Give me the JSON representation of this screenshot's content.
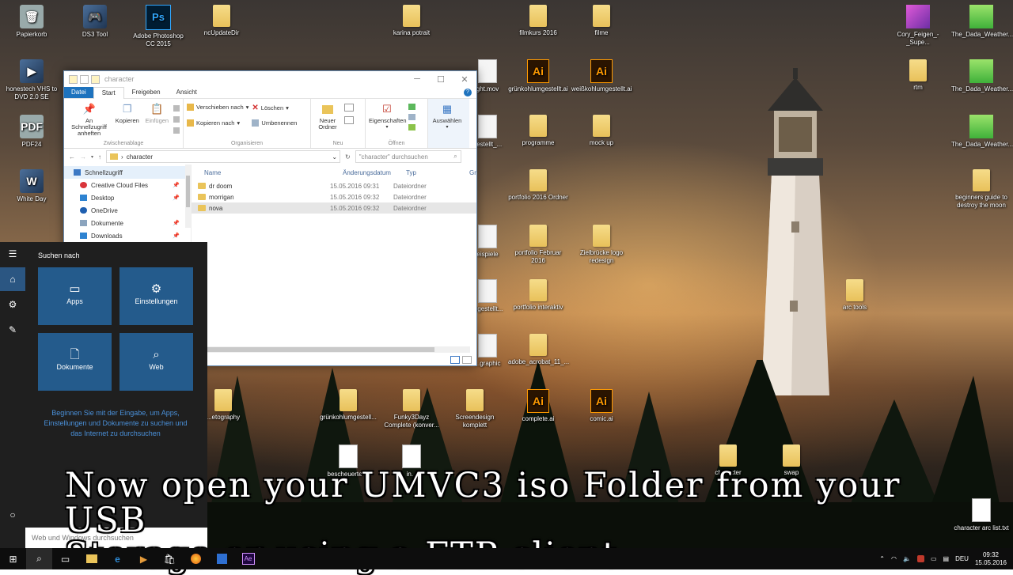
{
  "desktop": {
    "icons": [
      {
        "label": "Papierkorb",
        "kind": "app",
        "glyph": "🗑"
      },
      {
        "label": "DS3 Tool",
        "kind": "app",
        "glyph": "🎮"
      },
      {
        "label": "Adobe Photoshop CC 2015",
        "kind": "ps",
        "glyph": "Ps"
      },
      {
        "label": "ncUpdateDir",
        "kind": "folder",
        "glyph": ""
      },
      {
        "label": "karina potrait",
        "kind": "folder",
        "glyph": ""
      },
      {
        "label": "filmkurs 2016",
        "kind": "folder",
        "glyph": ""
      },
      {
        "label": "filme",
        "kind": "folder",
        "glyph": ""
      },
      {
        "label": "Cory_Feigen_-_Supe...",
        "kind": "pink",
        "glyph": ""
      },
      {
        "label": "The_Dada_Weather...",
        "kind": "green",
        "glyph": ""
      },
      {
        "label": "honestech VHS to DVD 2.0 SE",
        "kind": "app",
        "glyph": "▶"
      },
      {
        "label": "ght.mov",
        "kind": "file",
        "glyph": ""
      },
      {
        "label": "grünkohlumgestellt.ai",
        "kind": "ai",
        "glyph": "Ai"
      },
      {
        "label": "weißkohlumgestellt.ai",
        "kind": "ai",
        "glyph": "Ai"
      },
      {
        "label": "rtm",
        "kind": "folder",
        "glyph": ""
      },
      {
        "label": "The_Dada_Weather...",
        "kind": "green",
        "glyph": ""
      },
      {
        "label": "PDF24",
        "kind": "app",
        "glyph": "PDF"
      },
      {
        "label": "gestellt_...",
        "kind": "file",
        "glyph": ""
      },
      {
        "label": "programme",
        "kind": "folder",
        "glyph": ""
      },
      {
        "label": "mock up",
        "kind": "folder",
        "glyph": ""
      },
      {
        "label": "The_Dada_Weather...",
        "kind": "green",
        "glyph": ""
      },
      {
        "label": "White Day",
        "kind": "app",
        "glyph": "W"
      },
      {
        "label": "portfolio 2016 Ordner",
        "kind": "folder",
        "glyph": ""
      },
      {
        "label": "beginners guide to destroy the moon",
        "kind": "folder",
        "glyph": ""
      },
      {
        "label": "eispiele",
        "kind": "file",
        "glyph": ""
      },
      {
        "label": "portfolio Februar 2016",
        "kind": "folder",
        "glyph": ""
      },
      {
        "label": "Zielbrücke logo redesign",
        "kind": "folder",
        "glyph": ""
      },
      {
        "label": "mgestellt...",
        "kind": "file",
        "glyph": ""
      },
      {
        "label": "portfolio interaktiv",
        "kind": "folder",
        "glyph": ""
      },
      {
        "label": "arc tools",
        "kind": "folder",
        "glyph": ""
      },
      {
        "label": "...graphic",
        "kind": "file",
        "glyph": ""
      },
      {
        "label": "adobe_acrobat_11_...",
        "kind": "folder",
        "glyph": ""
      },
      {
        "label": "...etography",
        "kind": "folder",
        "glyph": ""
      },
      {
        "label": "grünkohlumgestell...",
        "kind": "folder",
        "glyph": ""
      },
      {
        "label": "Funky3Dayz Complete (konver...",
        "kind": "folder",
        "glyph": ""
      },
      {
        "label": "Screendesign komplett",
        "kind": "folder",
        "glyph": ""
      },
      {
        "label": "complete.ai",
        "kind": "ai",
        "glyph": "Ai"
      },
      {
        "label": "comic.ai",
        "kind": "ai",
        "glyph": "Ai"
      },
      {
        "label": "bescheuerte ...",
        "kind": "doc",
        "glyph": ""
      },
      {
        "label": "in...",
        "kind": "doc",
        "glyph": ""
      },
      {
        "label": "character",
        "kind": "folder",
        "glyph": ""
      },
      {
        "label": "swap",
        "kind": "folder",
        "glyph": ""
      },
      {
        "label": "character arc list.txt",
        "kind": "doc",
        "glyph": ""
      }
    ]
  },
  "explorer": {
    "title": "character",
    "tabs": [
      "Datei",
      "Start",
      "Freigeben",
      "Ansicht"
    ],
    "ribbon": {
      "clipboard": {
        "pin": "An Schnellzugriff anheften",
        "copy": "Kopieren",
        "paste": "Einfügen",
        "group": "Zwischenablage"
      },
      "organize": {
        "move": "Verschieben nach",
        "copyto": "Kopieren nach",
        "delete": "Löschen",
        "rename": "Umbenennen",
        "group": "Organisieren"
      },
      "new": {
        "folder": "Neuer Ordner",
        "group": "Neu"
      },
      "open": {
        "props": "Eigenschaften",
        "group": "Öffnen"
      },
      "select": {
        "select": "Auswählen"
      }
    },
    "address": "character",
    "search_placeholder": "\"character\" durchsuchen",
    "nav": [
      {
        "label": "Schnellzugriff",
        "color": "#3b78c4"
      },
      {
        "label": "Creative Cloud Files",
        "color": "#d9353b"
      },
      {
        "label": "Desktop",
        "color": "#2e83d1"
      },
      {
        "label": "OneDrive",
        "color": "#1e5fb0"
      },
      {
        "label": "Dokumente",
        "color": "#8ba4be"
      },
      {
        "label": "Downloads",
        "color": "#2e83d1"
      }
    ],
    "columns": {
      "name": "Name",
      "date": "Änderungsdatum",
      "type": "Typ",
      "size": "Gr"
    },
    "files": [
      {
        "name": "dr doom",
        "date": "15.05.2016 09:31",
        "type": "Dateiordner"
      },
      {
        "name": "morrigan",
        "date": "15.05.2016 09:32",
        "type": "Dateiordner"
      },
      {
        "name": "nova",
        "date": "15.05.2016 09:32",
        "type": "Dateiordner"
      }
    ]
  },
  "start": {
    "title": "Suchen nach",
    "tiles": {
      "apps": "Apps",
      "settings": "Einstellungen",
      "docs": "Dokumente",
      "web": "Web"
    },
    "hint": "Beginnen Sie mit der Eingabe, um Apps, Einstellungen und Dokumente zu suchen und das Internet zu durchsuchen",
    "search_placeholder": "Web und Windows durchsuchen"
  },
  "subtitle": {
    "line1": "Now open your UMVC3 iso Folder from your USB",
    "line2": "Storage or using a FTP client."
  },
  "taskbar": {
    "lang": "DEU",
    "time": "09:32",
    "date": "15.05.2016"
  }
}
